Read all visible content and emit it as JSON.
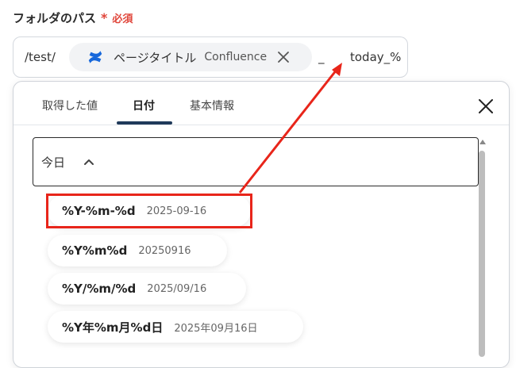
{
  "field": {
    "label": "フォルダのパス",
    "required_star": "*",
    "required_text": "必須"
  },
  "path": {
    "prefix": "/test/",
    "chip_title": "ページタイトル",
    "chip_source": "Confluence",
    "separator": "_",
    "suffix": "today_%"
  },
  "popup": {
    "tabs": [
      "取得した値",
      "日付",
      "基本情報"
    ],
    "active_tab": "日付",
    "section_title": "今日",
    "options": [
      {
        "format": "%Y-%m-%d",
        "example": "2025-09-16"
      },
      {
        "format": "%Y%m%d",
        "example": "20250916"
      },
      {
        "format": "%Y/%m/%d",
        "example": "2025/09/16"
      },
      {
        "format": "%Y年%m月%d日",
        "example": "2025年09月16日"
      }
    ]
  },
  "colors": {
    "required": "#e0453a",
    "highlight": "#e8251a",
    "tab_underline": "#1f3a5a",
    "confluence_blue": "#1868db"
  },
  "icons": {
    "chip_logo": "confluence-logo-icon",
    "chip_close": "close-icon",
    "popup_close": "close-icon",
    "section_toggle": "chevron-up-icon"
  }
}
